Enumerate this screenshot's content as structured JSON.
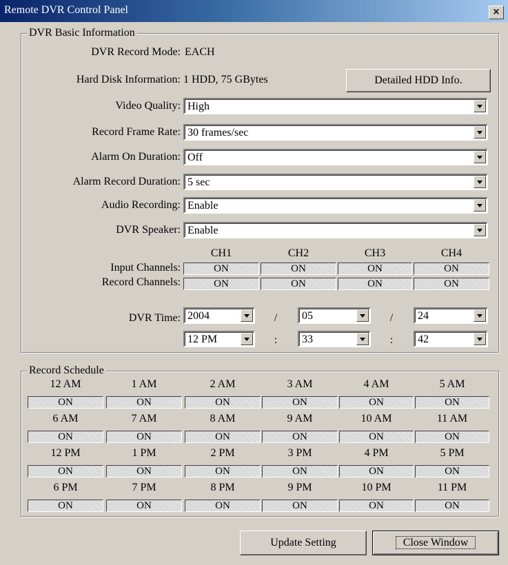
{
  "window": {
    "title": "Remote DVR Control Panel",
    "close_label": "×"
  },
  "basic_info": {
    "group_title": "DVR Basic Information",
    "record_mode_label": "DVR Record Mode:",
    "record_mode_value": "EACH",
    "hdd_label": "Hard Disk Information:",
    "hdd_value": "1 HDD, 75 GBytes",
    "hdd_button": "Detailed HDD Info.",
    "video_quality_label": "Video Quality:",
    "video_quality_value": "High",
    "frame_rate_label": "Record Frame Rate:",
    "frame_rate_value": "30 frames/sec",
    "alarm_on_label": "Alarm On Duration:",
    "alarm_on_value": "Off",
    "alarm_record_label": "Alarm Record Duration:",
    "alarm_record_value": "5 sec",
    "audio_label": "Audio Recording:",
    "audio_value": "Enable",
    "speaker_label": "DVR Speaker:",
    "speaker_value": "Enable",
    "channels": [
      "CH1",
      "CH2",
      "CH3",
      "CH4"
    ],
    "input_channels_label": "Input Channels:",
    "input_channels": [
      "ON",
      "ON",
      "ON",
      "ON"
    ],
    "record_channels_label": "Record Channels:",
    "record_channels": [
      "ON",
      "ON",
      "ON",
      "ON"
    ],
    "time_label": "DVR Time:",
    "year": "2004",
    "month": "05",
    "day": "24",
    "hour": "12 PM",
    "minute": "33",
    "second": "42",
    "date_sep": "/",
    "time_sep": ":"
  },
  "schedule": {
    "group_title": "Record Schedule",
    "hours": [
      "12 AM",
      "1 AM",
      "2 AM",
      "3 AM",
      "4 AM",
      "5 AM",
      "6 AM",
      "7 AM",
      "8 AM",
      "9 AM",
      "10 AM",
      "11 AM",
      "12 PM",
      "1 PM",
      "2 PM",
      "3 PM",
      "4 PM",
      "5 PM",
      "6 PM",
      "7 PM",
      "8 PM",
      "9 PM",
      "10 PM",
      "11 PM"
    ],
    "states": [
      "ON",
      "ON",
      "ON",
      "ON",
      "ON",
      "ON",
      "ON",
      "ON",
      "ON",
      "ON",
      "ON",
      "ON",
      "ON",
      "ON",
      "ON",
      "ON",
      "ON",
      "ON",
      "ON",
      "ON",
      "ON",
      "ON",
      "ON",
      "ON"
    ]
  },
  "footer": {
    "update_button": "Update Setting",
    "close_button": "Close Window"
  }
}
